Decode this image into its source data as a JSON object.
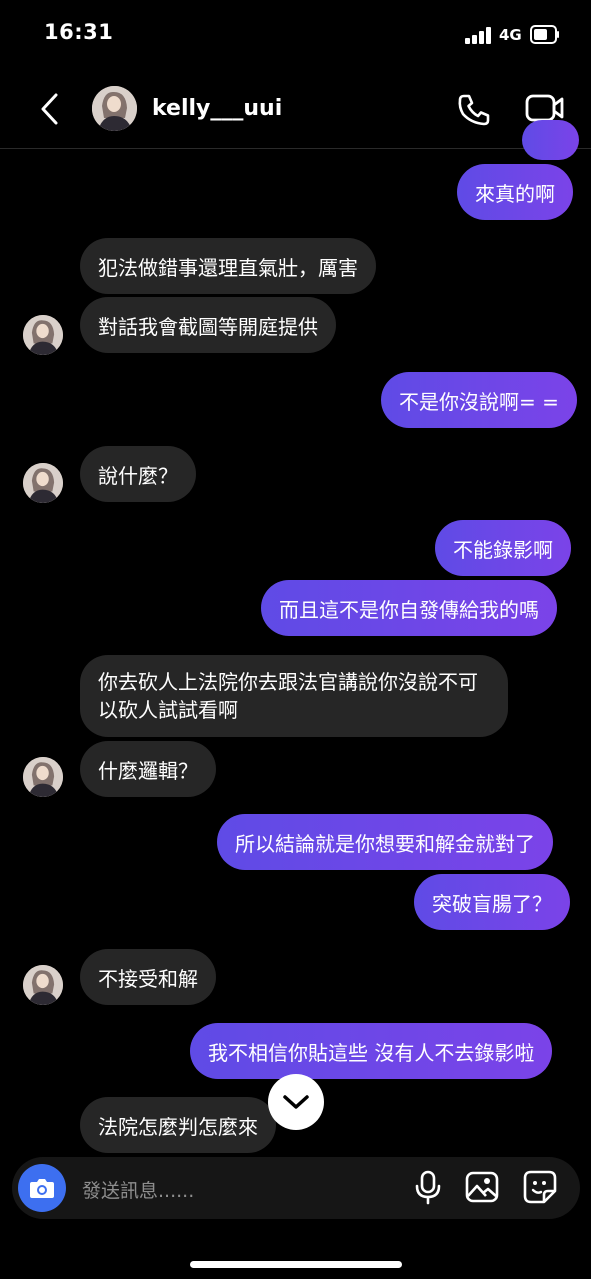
{
  "status": {
    "time": "16:31",
    "network": "4G"
  },
  "header": {
    "username": "kelly___uui"
  },
  "messages": [
    {
      "dir": "out",
      "text": "來真的啊"
    },
    {
      "dir": "in",
      "text": "犯法做錯事還理直氣壯，厲害"
    },
    {
      "dir": "in",
      "text": "對話我會截圖等開庭提供"
    },
    {
      "dir": "out",
      "text": "不是你沒說啊= ="
    },
    {
      "dir": "in",
      "text": "說什麼？"
    },
    {
      "dir": "out",
      "text": "不能錄影啊"
    },
    {
      "dir": "out",
      "text": "而且這不是你自發傳給我的嗎"
    },
    {
      "dir": "in",
      "text": "你去砍人上法院你去跟法官講說你沒說不可以砍人試試看啊"
    },
    {
      "dir": "in",
      "text": "什麼邏輯？"
    },
    {
      "dir": "out",
      "text": "所以結論就是你想要和解金就對了"
    },
    {
      "dir": "out",
      "text": "突破盲腸了？"
    },
    {
      "dir": "in",
      "text": "不接受和解"
    },
    {
      "dir": "out",
      "text": "我不相信你貼這些 沒有人不去錄影啦"
    },
    {
      "dir": "in",
      "text": "法院怎麼判怎麼來"
    }
  ],
  "composer": {
    "placeholder": "發送訊息......"
  },
  "colors": {
    "outgoing": "#6a47e8",
    "incoming": "#262626",
    "camera": "#3d6ff0"
  },
  "icons": [
    "back-icon",
    "phone-icon",
    "video-icon",
    "scroll-down-icon",
    "camera-icon",
    "microphone-icon",
    "gallery-icon",
    "sticker-icon"
  ]
}
